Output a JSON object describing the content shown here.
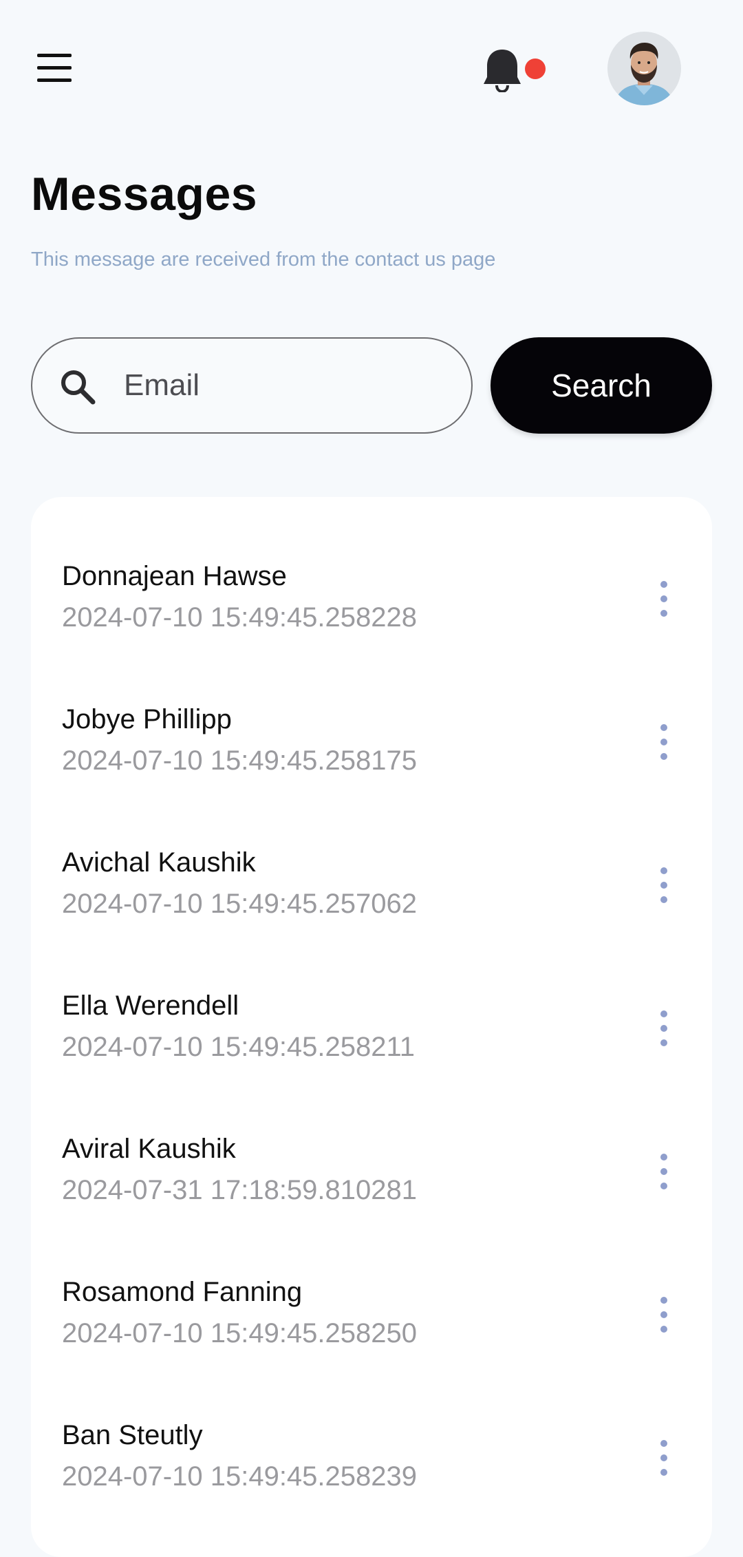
{
  "header": {
    "notification_dot_color": "#ef4136",
    "menu_icon": "hamburger-menu-icon",
    "bell_icon": "bell-icon"
  },
  "page": {
    "title": "Messages",
    "subtitle": "This message are received from the contact us page"
  },
  "search": {
    "placeholder": "Email",
    "value": "",
    "button_label": "Search"
  },
  "messages": [
    {
      "name": "Donnajean Hawse",
      "timestamp": "2024-07-10 15:49:45.258228"
    },
    {
      "name": "Jobye Phillipp",
      "timestamp": "2024-07-10 15:49:45.258175"
    },
    {
      "name": "Avichal Kaushik",
      "timestamp": "2024-07-10 15:49:45.257062"
    },
    {
      "name": "Ella Werendell",
      "timestamp": "2024-07-10 15:49:45.258211"
    },
    {
      "name": "Aviral Kaushik",
      "timestamp": "2024-07-31 17:18:59.810281"
    },
    {
      "name": "Rosamond Fanning",
      "timestamp": "2024-07-10 15:49:45.258250"
    },
    {
      "name": "Ban Steutly",
      "timestamp": "2024-07-10 15:49:45.258239"
    }
  ],
  "colors": {
    "background": "#f6f9fc",
    "accent_button": "#050408",
    "subtitle": "#8fa7c7",
    "kebab": "#8f9ecc"
  }
}
